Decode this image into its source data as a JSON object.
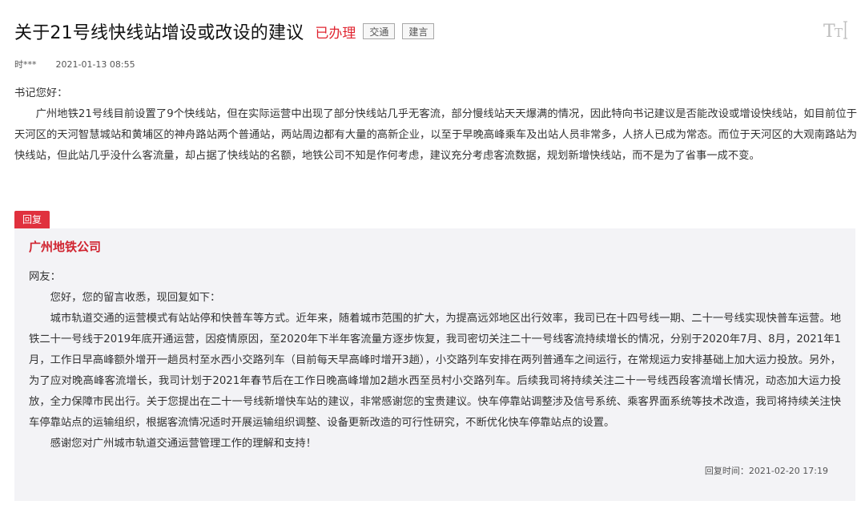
{
  "header": {
    "title": "关于21号线快线站增设或改设的建议",
    "status": "已办理",
    "tags": [
      "交通",
      "建言"
    ]
  },
  "meta": {
    "author": "时***",
    "date": "2021-01-13 08:55"
  },
  "message": {
    "greeting": "书记您好：",
    "body": "广州地铁21号线目前设置了9个快线站，但在实际运营中出现了部分快线站几乎无客流，部分慢线站天天爆满的情况，因此特向书记建议是否能改设或增设快线站，如目前位于天河区的天河智慧城站和黄埔区的神舟路站两个普通站，两站周边都有大量的高新企业，以至于早晚高峰乘车及出站人员非常多，人挤人已成为常态。而位于天河区的大观南路站为快线站，但此站几乎没什么客流量，却占据了快线站的名额，地铁公司不知是作何考虑，建议充分考虑客流数据，规划新增快线站，而不是为了省事一成不变。"
  },
  "reply": {
    "label": "回复",
    "org": "广州地铁公司",
    "salutation": "网友：",
    "opening": "您好，您的留言收悉，现回复如下：",
    "body": "城市轨道交通的运营模式有站站停和快普车等方式。近年来，随着城市范围的扩大，为提高远郊地区出行效率，我司已在十四号线一期、二十一号线实现快普车运营。地铁二十一号线于2019年底开通运营，因疫情原因，至2020年下半年客流量方逐步恢复，我司密切关注二十一号线客流持续增长的情况，分别于2020年7月、8月，2021年1月，工作日早高峰额外增开一趟员村至水西小交路列车（目前每天早高峰时增开3趟），小交路列车安排在两列普通车之间运行，在常规运力安排基础上加大运力投放。另外，为了应对晚高峰客流增长，我司计划于2021年春节后在工作日晚高峰增加2趟水西至员村小交路列车。后续我司将持续关注二十一号线西段客流增长情况，动态加大运力投放，全力保障市民出行。关于您提出在二十一号线新增快车站的建议，非常感谢您的宝贵建议。快车停靠站调整涉及信号系统、乘客界面系统等技术改造，我司将持续关注快车停靠站点的运输组织，根据客流情况适时开展运输组织调整、设备更新改造的可行性研究，不断优化快车停靠站点的设置。",
    "closing": "感谢您对广州城市轨道交通运营管理工作的理解和支持！",
    "time_label": "回复时间：",
    "time": "2021-02-20 17:19"
  },
  "icons": {
    "font_size": "font-size-toggle-icon"
  },
  "colors": {
    "accent_red": "#e0313e",
    "org_red": "#d0232f",
    "reply_bg": "#f3f3f6"
  }
}
